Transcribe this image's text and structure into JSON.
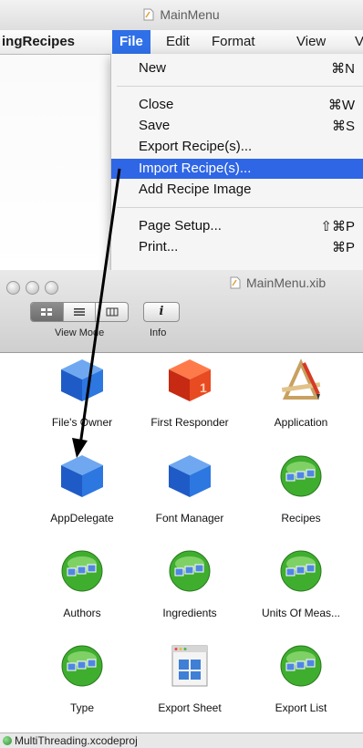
{
  "window": {
    "title": "MainMenu"
  },
  "menubar": {
    "app": "ingRecipes",
    "items": [
      {
        "label": "File"
      },
      {
        "label": "Edit"
      },
      {
        "label": "Format"
      },
      {
        "label": "View"
      },
      {
        "label": "V"
      }
    ]
  },
  "file_menu": {
    "items": [
      {
        "label": "New",
        "shortcut": "⌘N"
      },
      {
        "label": "Close",
        "shortcut": "⌘W"
      },
      {
        "label": "Save",
        "shortcut": "⌘S"
      },
      {
        "label": "Export Recipe(s)...",
        "shortcut": ""
      },
      {
        "label": "Import Recipe(s)...",
        "shortcut": ""
      },
      {
        "label": "Add Recipe Image",
        "shortcut": ""
      },
      {
        "label": "Page Setup...",
        "shortcut": "⇧⌘P"
      },
      {
        "label": "Print...",
        "shortcut": "⌘P"
      }
    ]
  },
  "xib_window": {
    "title": "MainMenu.xib",
    "toolbar": {
      "view_mode_label": "View Mode",
      "info_label": "Info",
      "info_glyph": "i"
    },
    "objects": [
      {
        "label": "File's Owner",
        "icon": "blue-cube-icon"
      },
      {
        "label": "First Responder",
        "icon": "red-cube-icon"
      },
      {
        "label": "Application",
        "icon": "application-icon"
      },
      {
        "label": "AppDelegate",
        "icon": "blue-cube-icon"
      },
      {
        "label": "Font Manager",
        "icon": "blue-cube-icon"
      },
      {
        "label": "Recipes",
        "icon": "array-controller-icon"
      },
      {
        "label": "Authors",
        "icon": "array-controller-icon"
      },
      {
        "label": "Ingredients",
        "icon": "array-controller-icon"
      },
      {
        "label": "Units Of Meas...",
        "icon": "array-controller-icon"
      },
      {
        "label": "Type",
        "icon": "array-controller-icon"
      },
      {
        "label": "Export Sheet",
        "icon": "window-icon"
      },
      {
        "label": "Export List",
        "icon": "array-controller-icon"
      }
    ],
    "status": "MultiThreading.xcodeproj"
  },
  "colors": {
    "selection": "#2f66e6",
    "arrow": "#000000"
  }
}
